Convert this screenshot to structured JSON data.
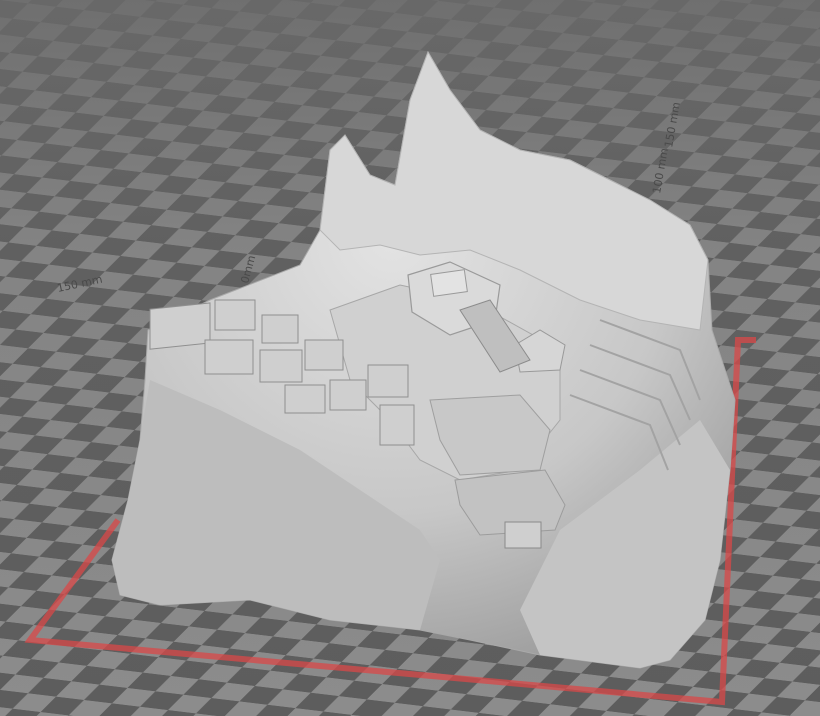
{
  "viewport": {
    "axis_labels": {
      "left": "150 mm",
      "center": "0mm",
      "right_top": "150 mm",
      "right_mid": "100 mm"
    },
    "colors": {
      "grid_light": "#8a8a8a",
      "grid_dark": "#5c5c5c",
      "build_plate_outline": "#d94848",
      "model": "#c9c9c9"
    }
  }
}
